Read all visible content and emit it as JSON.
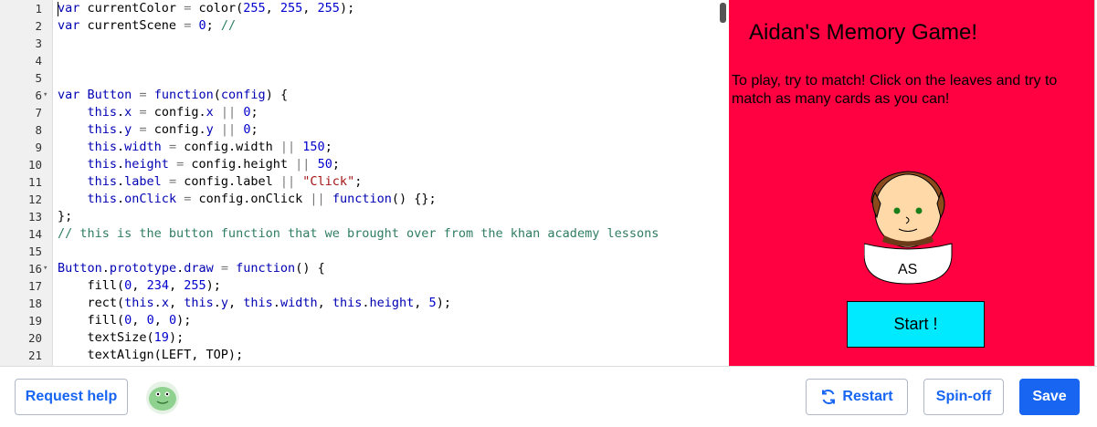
{
  "editor": {
    "lines": [
      {
        "n": "1",
        "fold": "",
        "html": "<span class=\"kw\">var</span> currentColor <span class=\"op\">=</span> color(<span class=\"num\">255</span>, <span class=\"num\">255</span>, <span class=\"num\">255</span>);"
      },
      {
        "n": "2",
        "fold": "",
        "html": "<span class=\"kw\">var</span> currentScene <span class=\"op\">=</span> <span class=\"num\">0</span>; <span class=\"cmt\">//</span>"
      },
      {
        "n": "3",
        "fold": "",
        "html": ""
      },
      {
        "n": "4",
        "fold": "",
        "html": ""
      },
      {
        "n": "5",
        "fold": "",
        "html": ""
      },
      {
        "n": "6",
        "fold": "▾",
        "html": "<span class=\"kw\">var</span> <span class=\"kw\">Button</span> <span class=\"op\">=</span> <span class=\"kw\">function</span>(<span class=\"kw\">config</span>) {"
      },
      {
        "n": "7",
        "fold": "",
        "html": "    <span class=\"kw\">this</span>.<span class=\"kw\">x</span> <span class=\"op\">=</span> config.<span class=\"kw\">x</span> <span class=\"op\">||</span> <span class=\"num\">0</span>;"
      },
      {
        "n": "8",
        "fold": "",
        "html": "    <span class=\"kw\">this</span>.<span class=\"kw\">y</span> <span class=\"op\">=</span> config.<span class=\"kw\">y</span> <span class=\"op\">||</span> <span class=\"num\">0</span>;"
      },
      {
        "n": "9",
        "fold": "",
        "html": "    <span class=\"kw\">this</span>.<span class=\"kw\">width</span> <span class=\"op\">=</span> config.width <span class=\"op\">||</span> <span class=\"num\">150</span>;"
      },
      {
        "n": "10",
        "fold": "",
        "html": "    <span class=\"kw\">this</span>.<span class=\"kw\">height</span> <span class=\"op\">=</span> config.height <span class=\"op\">||</span> <span class=\"num\">50</span>;"
      },
      {
        "n": "11",
        "fold": "",
        "html": "    <span class=\"kw\">this</span>.<span class=\"kw\">label</span> <span class=\"op\">=</span> config.label <span class=\"op\">||</span> <span class=\"str\">\"Click\"</span>;"
      },
      {
        "n": "12",
        "fold": "",
        "html": "    <span class=\"kw\">this</span>.<span class=\"kw\">onClick</span> <span class=\"op\">=</span> config.onClick <span class=\"op\">||</span> <span class=\"kw\">function</span>() {};"
      },
      {
        "n": "13",
        "fold": "",
        "html": "};"
      },
      {
        "n": "14",
        "fold": "",
        "html": "<span class=\"cmt\">// this is the button function that we brought over from the khan academy lessons</span>"
      },
      {
        "n": "15",
        "fold": "",
        "html": ""
      },
      {
        "n": "16",
        "fold": "▾",
        "html": "<span class=\"kw\">Button</span>.<span class=\"kw\">prototype</span>.<span class=\"kw\">draw</span> <span class=\"op\">=</span> <span class=\"kw\">function</span>() {"
      },
      {
        "n": "17",
        "fold": "",
        "html": "    fill(<span class=\"num\">0</span>, <span class=\"num\">234</span>, <span class=\"num\">255</span>);"
      },
      {
        "n": "18",
        "fold": "",
        "html": "    rect(<span class=\"kw\">this</span>.<span class=\"kw\">x</span>, <span class=\"kw\">this</span>.<span class=\"kw\">y</span>, <span class=\"kw\">this</span>.<span class=\"kw\">width</span>, <span class=\"kw\">this</span>.<span class=\"kw\">height</span>, <span class=\"num\">5</span>);"
      },
      {
        "n": "19",
        "fold": "",
        "html": "    fill(<span class=\"num\">0</span>, <span class=\"num\">0</span>, <span class=\"num\">0</span>);"
      },
      {
        "n": "20",
        "fold": "",
        "html": "    textSize(<span class=\"num\">19</span>);"
      },
      {
        "n": "21",
        "fold": "",
        "html": "    textAlign(LEFT, TOP);"
      }
    ]
  },
  "canvas": {
    "title": "Aidan's Memory Game!",
    "description": "To play, try to match! Click on the leaves and try to match as many cards as you can!",
    "avatar_initials": "AS",
    "start_label": "Start !",
    "bg_color": "#ff0040",
    "button_color": "#00eaff"
  },
  "toolbar": {
    "request_help": "Request help",
    "restart": "Restart",
    "spinoff": "Spin-off",
    "save": "Save",
    "accent_color": "#1865f2"
  }
}
